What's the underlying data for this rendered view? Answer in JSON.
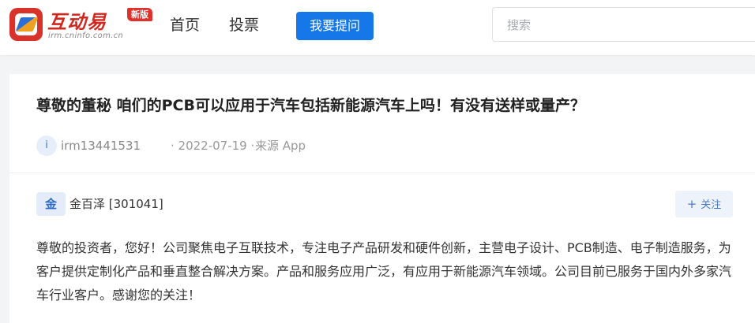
{
  "header": {
    "logo_title": "互动易",
    "logo_badge": "新版",
    "logo_subtitle": "irm.cninfo.com.cn",
    "nav": [
      {
        "label": "首页"
      },
      {
        "label": "投票"
      }
    ],
    "ask_button": "我要提问",
    "search_placeholder": "搜索"
  },
  "question": {
    "title": "尊敬的董秘 咱们的PCB可以应用于汽车包括新能源汽车上吗！有没有送样或量产？",
    "avatar_letter": "i",
    "user": "irm13441531",
    "date": "· 2022-07-19 ·",
    "source": "来源 App"
  },
  "answer": {
    "avatar_text": "金",
    "answerer": "金百泽 [301041]",
    "follow_button": "关注",
    "follow_icon": "plus-icon",
    "text": "尊敬的投资者，您好！公司聚焦电子互联技术，专注电子产品研发和硬件创新，主营电子设计、PCB制造、电子制造服务，为客户提供定制化产品和垂直整合解决方案。产品和服务应用广泛，有应用于新能源汽车领域。公司目前已服务于国内外多家汽车行业客户。感谢您的关注！"
  },
  "colors": {
    "brand_red": "#d0271f",
    "primary_blue": "#1677e8",
    "background": "#f3f4f6"
  }
}
